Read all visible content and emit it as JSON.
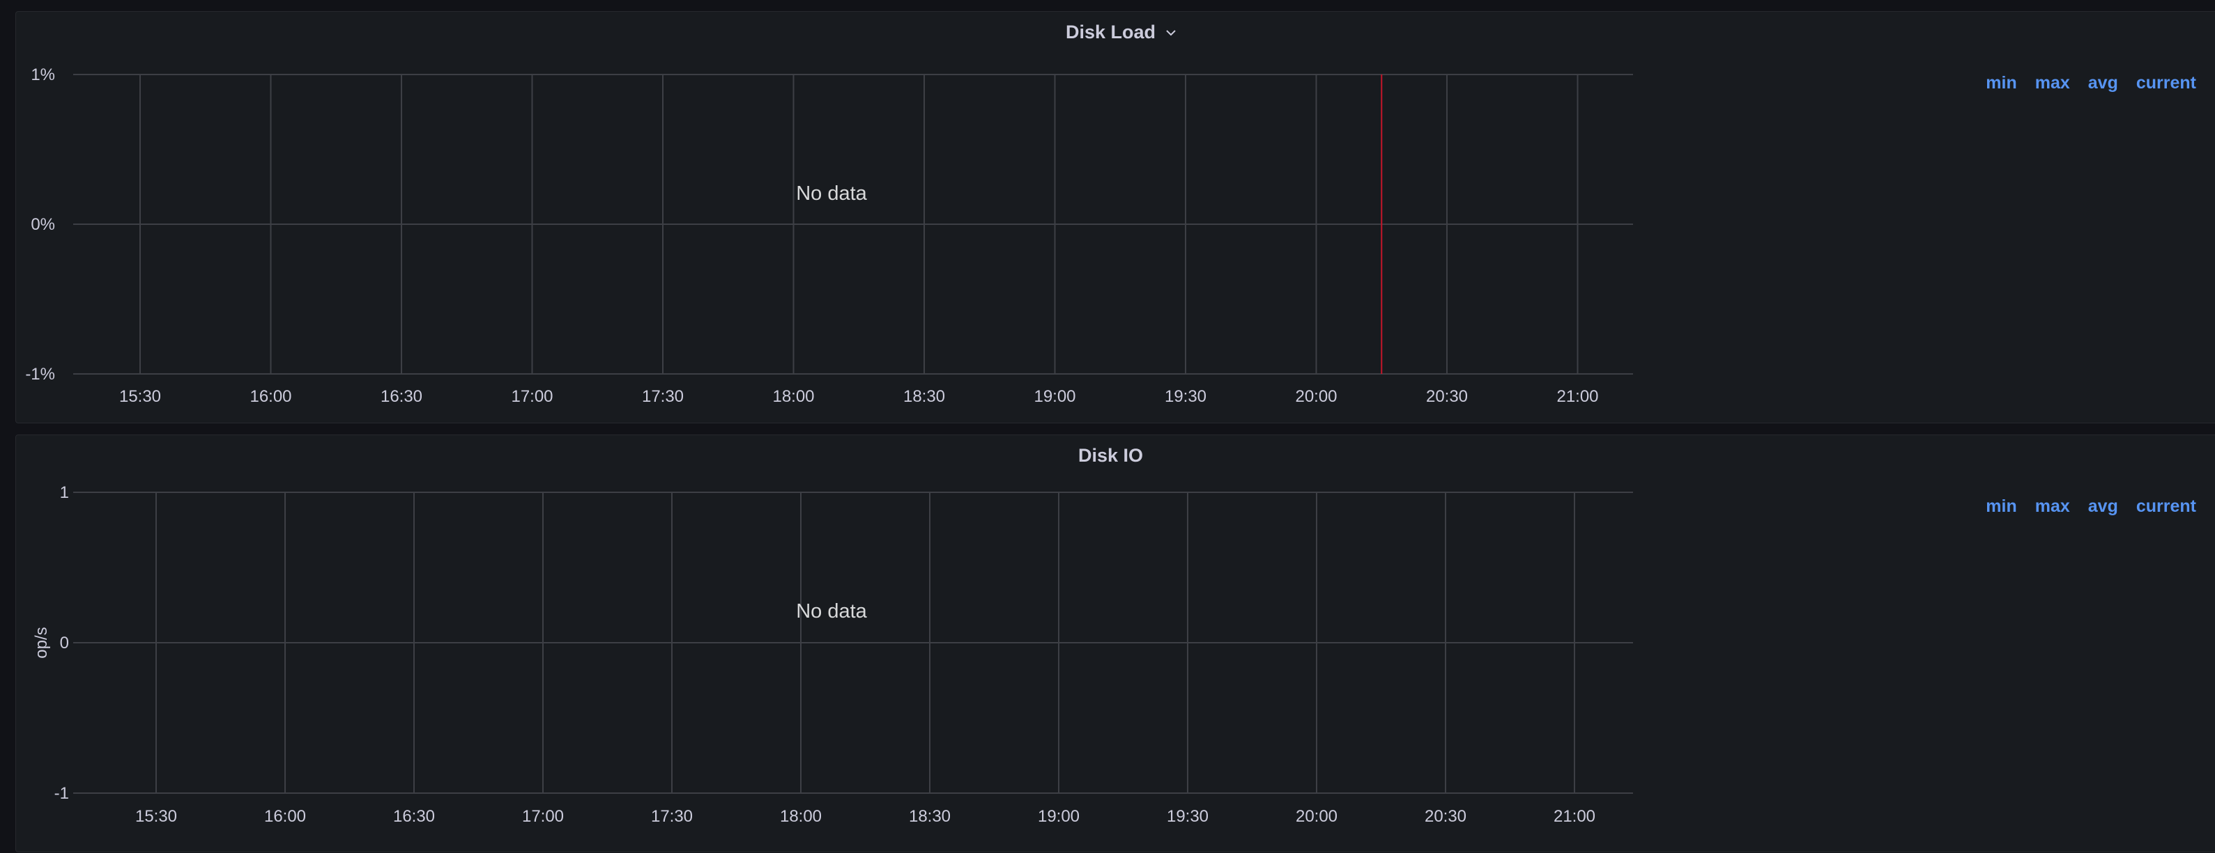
{
  "panels": [
    {
      "title": "Disk Load",
      "has_menu_chevron": true,
      "no_data_text": "No data",
      "legend": [
        "min",
        "max",
        "avg",
        "current"
      ],
      "y_ticks": [
        "1%",
        "0%",
        "-1%"
      ],
      "y_label": "",
      "x_ticks": [
        "15:30",
        "16:00",
        "16:30",
        "17:00",
        "17:30",
        "18:00",
        "18:30",
        "19:00",
        "19:30",
        "20:00",
        "20:30",
        "21:00"
      ],
      "annotation_time": "20:15"
    },
    {
      "title": "Disk IO",
      "has_menu_chevron": false,
      "no_data_text": "No data",
      "legend": [
        "min",
        "max",
        "avg",
        "current"
      ],
      "y_ticks": [
        "1",
        "0",
        "-1"
      ],
      "y_label": "op/s",
      "x_ticks": [
        "15:30",
        "16:00",
        "16:30",
        "17:00",
        "17:30",
        "18:00",
        "18:30",
        "19:00",
        "19:30",
        "20:00",
        "20:30",
        "21:00"
      ]
    }
  ],
  "colors": {
    "background": "#111217",
    "panel": "#181b1f",
    "grid": "#3d3f45",
    "text": "#ccccdc",
    "legend_link": "#5794f2",
    "annotation": "#c4162a"
  }
}
